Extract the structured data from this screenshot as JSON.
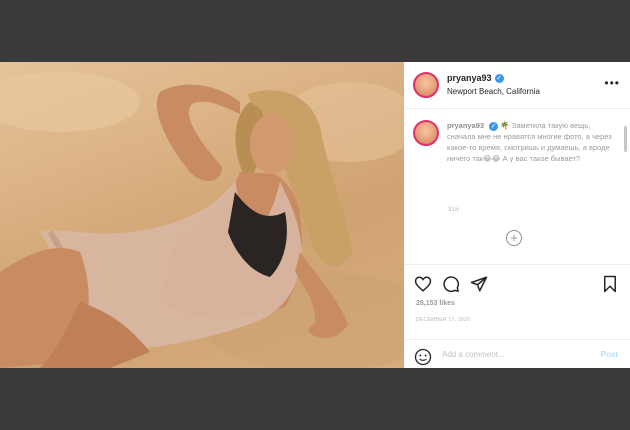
{
  "post": {
    "username": "pryanya93",
    "location": "Newport Beach, California",
    "verified_glyph": "✓",
    "more_glyph": "•••"
  },
  "caption": {
    "username": "pryanya93",
    "text": "🌴 Заметила такую вещь, сначала мне не нравятся многие фото, а через какое-то время, смотришь и думаешь, а вроде ничего так😂😂 А у вас такое бывает?",
    "time": "31w"
  },
  "load_more_glyph": "+",
  "likes": "28,153 likes",
  "date": "DECEMBER 17, 2020",
  "comment_box": {
    "placeholder": "Add a comment...",
    "post_label": "Post"
  },
  "icons": [
    "heart-icon",
    "comment-icon",
    "share-icon",
    "bookmark-icon",
    "emoji-icon"
  ],
  "colors": {
    "backdrop": "#3a3a3c",
    "verified": "#3897f0",
    "post_button": "#b2dffc",
    "sand": "#d9b081"
  }
}
